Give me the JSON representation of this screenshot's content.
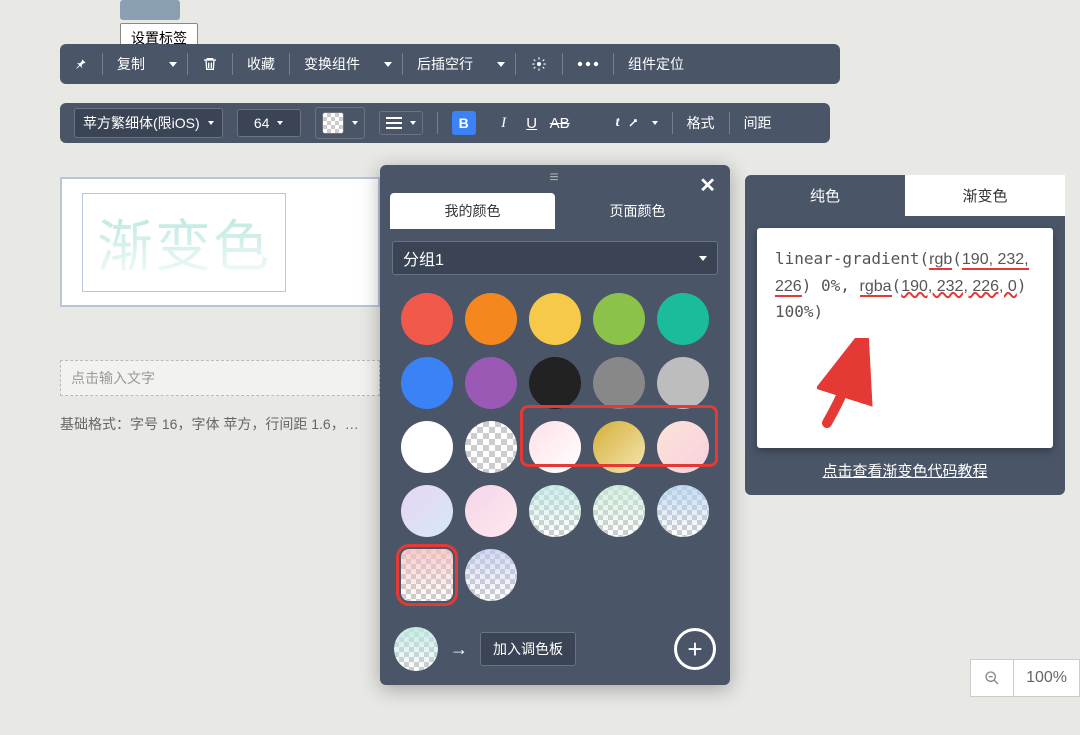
{
  "tag_button": "设置标签",
  "toolbar1": {
    "copy": "复制",
    "collect": "收藏",
    "transform": "变换组件",
    "insert_blank": "后插空行",
    "locate": "组件定位"
  },
  "toolbar2": {
    "font": "苹方繁细体(限iOS)",
    "size": "64",
    "format": "格式",
    "spacing": "间距"
  },
  "canvas": {
    "gradient_text": "渐变色",
    "placeholder": "点击输入文字",
    "meta": "基础格式：字号 16，字体 苹方，行间距 1.6，…"
  },
  "color_panel": {
    "tab_my": "我的颜色",
    "tab_page": "页面颜色",
    "group_select": "分组1",
    "add_palette": "加入调色板",
    "swatches_solid": [
      "#f15a4a",
      "#f5871f",
      "#f7c948",
      "#8bc34a",
      "#1abc9c",
      "#3b82f6",
      "#9b59b6",
      "#222222",
      "#888888",
      "#bdbdbd"
    ]
  },
  "grad_panel": {
    "tab_solid": "纯色",
    "tab_grad": "渐变色",
    "code": "linear-gradient(rgb(190, 232, 226) 0%, rgba(190, 232, 226, 0) 100%)",
    "link": "点击查看渐变色代码教程"
  },
  "zoom": {
    "value": "100%"
  }
}
